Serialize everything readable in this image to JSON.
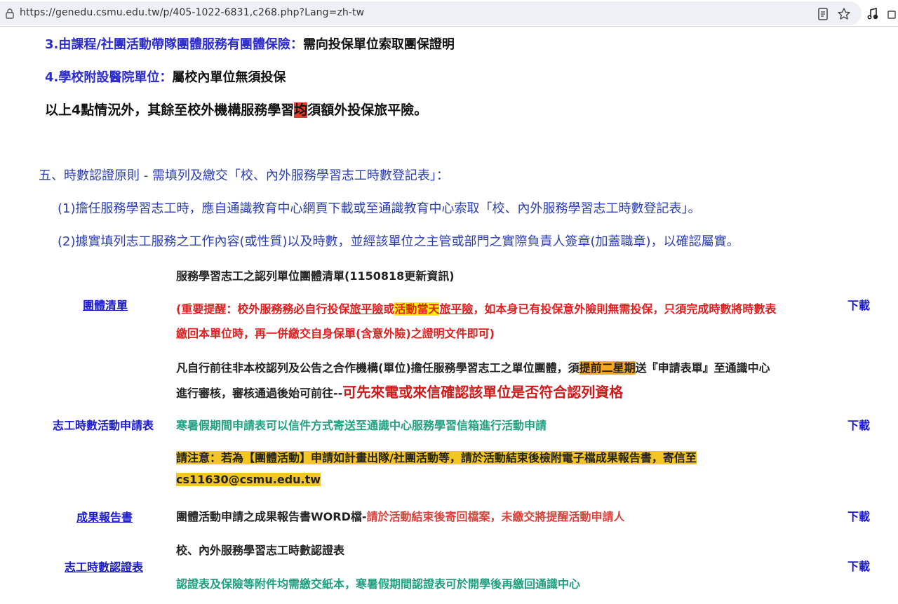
{
  "browser": {
    "url": "https://genedu.csmu.edu.tw/p/405-1022-6831,c268.php?Lang=zh-tw"
  },
  "insurance": {
    "item3_label": "3.由課程/社團活動帶隊團體服務有團體保險：",
    "item3_text": "需向投保單位索取團保證明",
    "item4_label": "4.學校附設醫院單位：",
    "item4_text": "屬校內單位無須投保",
    "summary_pre": "以上4點情況外，其餘至校外機構服務學習",
    "summary_hl": "均",
    "summary_post": "須額外投保旅平險。"
  },
  "section5": {
    "title": "五、時數認證原則 - 需填列及繳交「校、內外服務學習志工時數登記表」：",
    "point1": "(1)擔任服務學習志工時，應自通識教育中心網頁下載或至通識教育中心索取「校、內外服務學習志工時數登記表」。",
    "point2": "(2)據實填列志工服務之工作內容(或性質)以及時數，並經該單位之主管或部門之實際負責人簽章(加蓋職章)，以確認屬實。"
  },
  "rows": {
    "group_list": {
      "label": "團體清單",
      "title": "服務學習志工之認列單位團體清單(1150818更新資訊)",
      "note_a": "(重要提醒：校外服務務必自行投保",
      "note_b": "旅平險",
      "note_c": "或",
      "note_d": "活動當天",
      "note_e": "旅平險",
      "note_f": "，如本身已有投保意外險則無需投保，只須完成時數將時數表",
      "note_line2": "繳回本單位時，再一併繳交自身保單(含意外險)之證明文件即可)",
      "download": "下載"
    },
    "application": {
      "label": "志工時數活動申請表",
      "p1_a": "凡自行前往非本校認列及公告之合作機構(單位)擔任服務學習志工之單位團體，須",
      "p1_hl": "提前二星期",
      "p1_b": "送『申請表單』至通識中心",
      "p1_line2": "進行審核，審核通過後始可前往--",
      "p1_big": "可先來電或來信確認該單位是否符合認列資格",
      "p2": "寒暑假期間申請表可以信件方式寄送至通識中心服務學習信箱進行活動申請",
      "p3_line1": "請注意：若為【團體活動】申請如計畫出隊/社團活動等，請於活動結束後檢附電子檔成果報告書，寄信至",
      "p3_line2": "cs11630@csmu.edu.tw",
      "download": "下載"
    },
    "report": {
      "label": "成果報告書",
      "text_a": "團體活動申請之成果報告書WORD檔-",
      "text_b": "請於活動結束後寄回檔案，未繳交將提醒活動申請人",
      "download": "下載"
    },
    "certificate": {
      "label": "志工時數認證表",
      "title": "校、內外服務學習志工時數認證表",
      "note": "認證表及保險等附件均需繳交紙本，寒暑假期間認證表可於開學後再繳回通識中心",
      "download": "下載"
    }
  }
}
